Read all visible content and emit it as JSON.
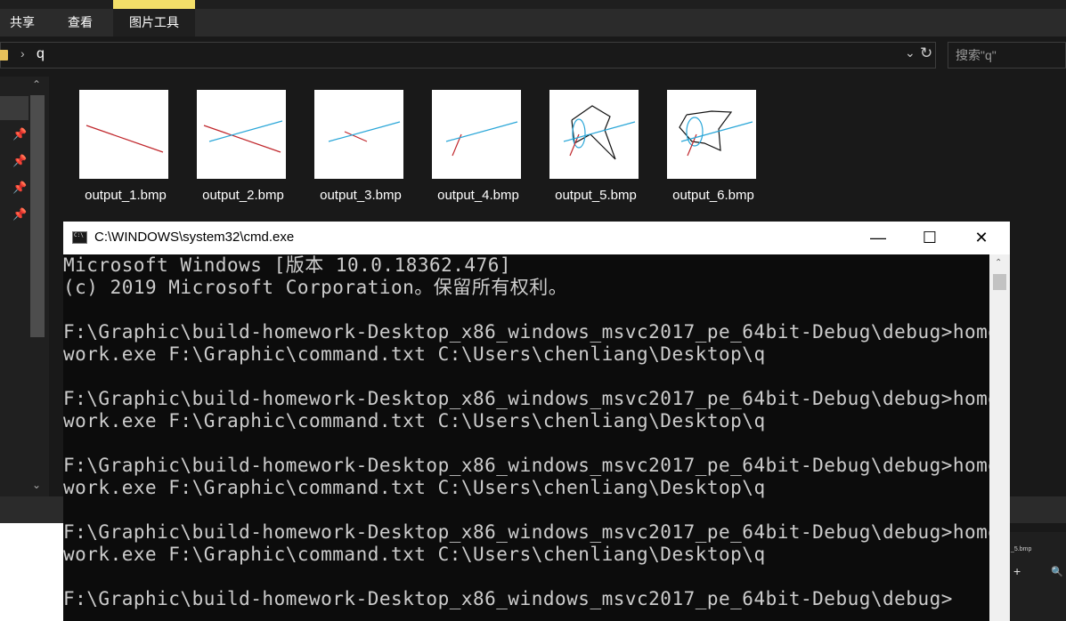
{
  "ribbon": {
    "tabs": [
      {
        "label": "共享"
      },
      {
        "label": "查看"
      },
      {
        "label": "图片工具"
      }
    ]
  },
  "addressbar": {
    "path": "q",
    "search_placeholder": "搜索\"q\""
  },
  "files": [
    {
      "name": "output_1.bmp"
    },
    {
      "name": "output_2.bmp"
    },
    {
      "name": "output_3.bmp"
    },
    {
      "name": "output_4.bmp"
    },
    {
      "name": "output_5.bmp"
    },
    {
      "name": "output_6.bmp"
    }
  ],
  "cmd": {
    "title": "C:\\WINDOWS\\system32\\cmd.exe",
    "lines": [
      "Microsoft Windows [版本 10.0.18362.476]",
      "(c) 2019 Microsoft Corporation。保留所有权利。",
      "",
      "F:\\Graphic\\build-homework-Desktop_x86_windows_msvc2017_pe_64bit-Debug\\debug>home",
      "work.exe F:\\Graphic\\command.txt C:\\Users\\chenliang\\Desktop\\q",
      "",
      "F:\\Graphic\\build-homework-Desktop_x86_windows_msvc2017_pe_64bit-Debug\\debug>home",
      "work.exe F:\\Graphic\\command.txt C:\\Users\\chenliang\\Desktop\\q",
      "",
      "F:\\Graphic\\build-homework-Desktop_x86_windows_msvc2017_pe_64bit-Debug\\debug>home",
      "work.exe F:\\Graphic\\command.txt C:\\Users\\chenliang\\Desktop\\q",
      "",
      "F:\\Graphic\\build-homework-Desktop_x86_windows_msvc2017_pe_64bit-Debug\\debug>home",
      "work.exe F:\\Graphic\\command.txt C:\\Users\\chenliang\\Desktop\\q",
      "",
      "F:\\Graphic\\build-homework-Desktop_x86_windows_msvc2017_pe_64bit-Debug\\debug>"
    ]
  },
  "side_preview": {
    "label": "_5.bmp"
  },
  "colors": {
    "explorer_bg": "#191919",
    "accent": "#f3df69",
    "console_bg": "#0c0c0c",
    "console_text": "#cccccc",
    "line_red": "#c0262b",
    "line_blue": "#29a6d8"
  }
}
